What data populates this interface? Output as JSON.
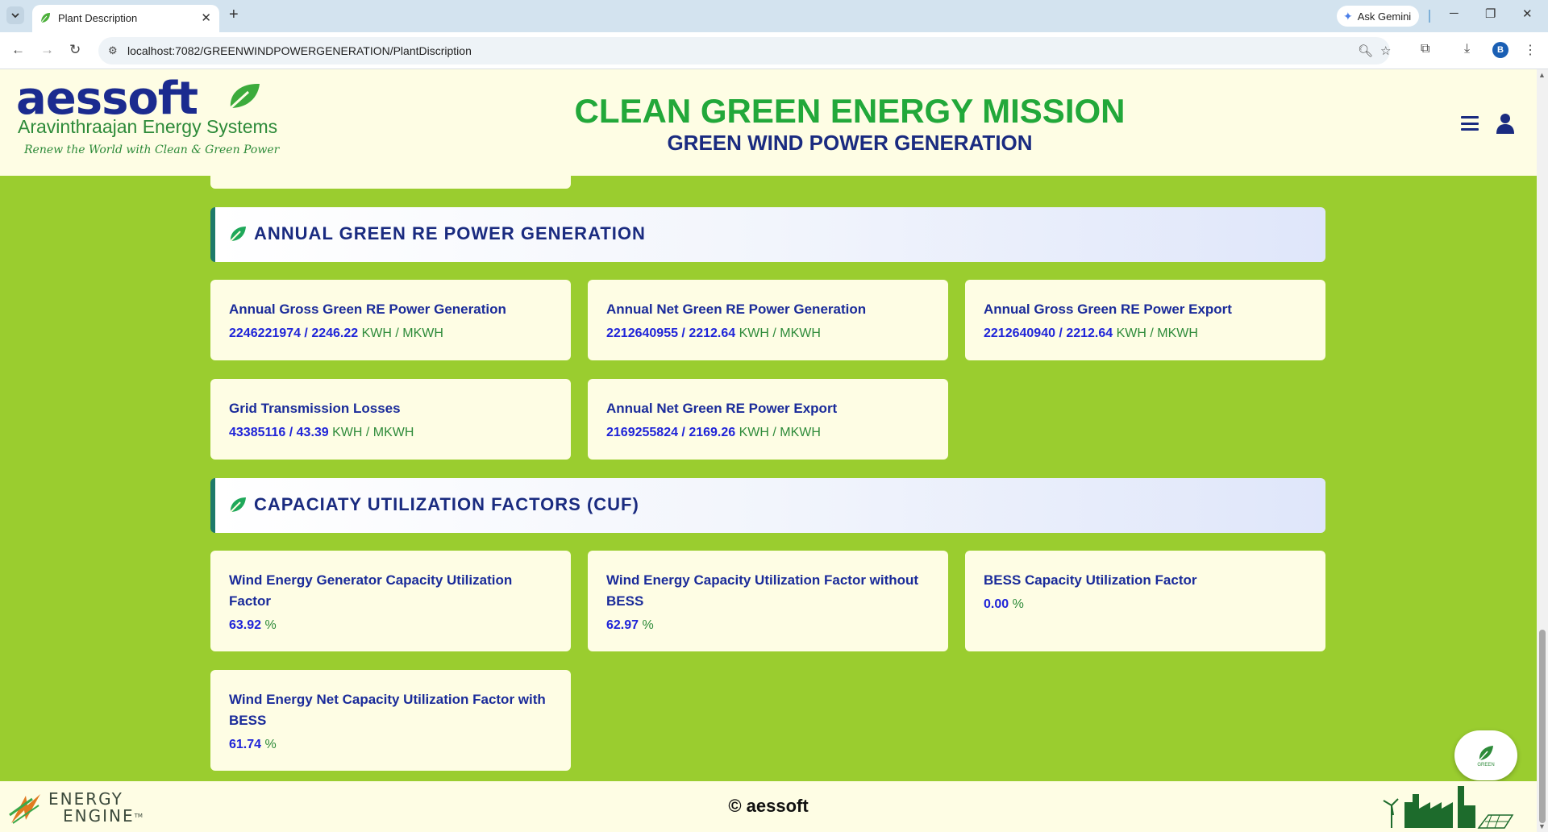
{
  "browser": {
    "tab_title": "Plant Description",
    "new_tab_symbol": "+",
    "gemini_label": "Ask Gemini",
    "url": "localhost:7082/GREENWINDPOWERGENERATION/PlantDiscription",
    "profile_initial": "B"
  },
  "header": {
    "logo_text": "aessoft",
    "logo_subtitle": "Aravinthraajan Energy Systems",
    "logo_tagline": "Renew the World with Clean & Green Power",
    "mission_title": "CLEAN GREEN ENERGY MISSION",
    "mission_subtitle": "GREEN WIND POWER GENERATION"
  },
  "sections": [
    {
      "title": "ANNUAL GREEN RE POWER GENERATION",
      "cards": [
        {
          "title": "Annual Gross Green RE Power Generation",
          "value": "2246221974 / 2246.22",
          "unit": " KWH / MKWH"
        },
        {
          "title": "Annual Net Green RE Power Generation",
          "value": "2212640955 / 2212.64",
          "unit": " KWH / MKWH"
        },
        {
          "title": "Annual Gross Green RE Power Export",
          "value": "2212640940 / 2212.64",
          "unit": " KWH / MKWH"
        },
        {
          "title": "Grid Transmission Losses",
          "value": "43385116 / 43.39",
          "unit": " KWH / MKWH"
        },
        {
          "title": "Annual Net Green RE Power Export",
          "value": "2169255824 / 2169.26",
          "unit": " KWH / MKWH"
        }
      ]
    },
    {
      "title": "CAPACIATY UTILIZATION FACTORS (CUF)",
      "cards": [
        {
          "title": "Wind Energy Generator Capacity Utilization Factor",
          "value": "63.92",
          "unit": " %"
        },
        {
          "title": "Wind Energy Capacity Utilization Factor without BESS",
          "value": "62.97",
          "unit": " %"
        },
        {
          "title": "BESS Capacity Utilization Factor",
          "value": "0.00",
          "unit": " %"
        },
        {
          "title": "Wind Energy Net Capacity Utilization Factor with BESS",
          "value": "61.74",
          "unit": " %"
        }
      ]
    }
  ],
  "fab": {
    "label": "GREEN"
  },
  "footer": {
    "brand_line1": "ENERGY",
    "brand_line2": "ENGINE",
    "brand_tm": "TM",
    "copyright": "© aessoft"
  },
  "colors": {
    "page_background": "#9acd2f",
    "card_background": "#fefde4",
    "title_blue": "#1a2b9a",
    "value_blue": "#1f24d8",
    "unit_green": "#2e8b3a",
    "mission_green": "#22a83a"
  },
  "icons": {
    "section": "leaf-icon",
    "menu": "hamburger-menu-icon",
    "account": "user-icon"
  }
}
